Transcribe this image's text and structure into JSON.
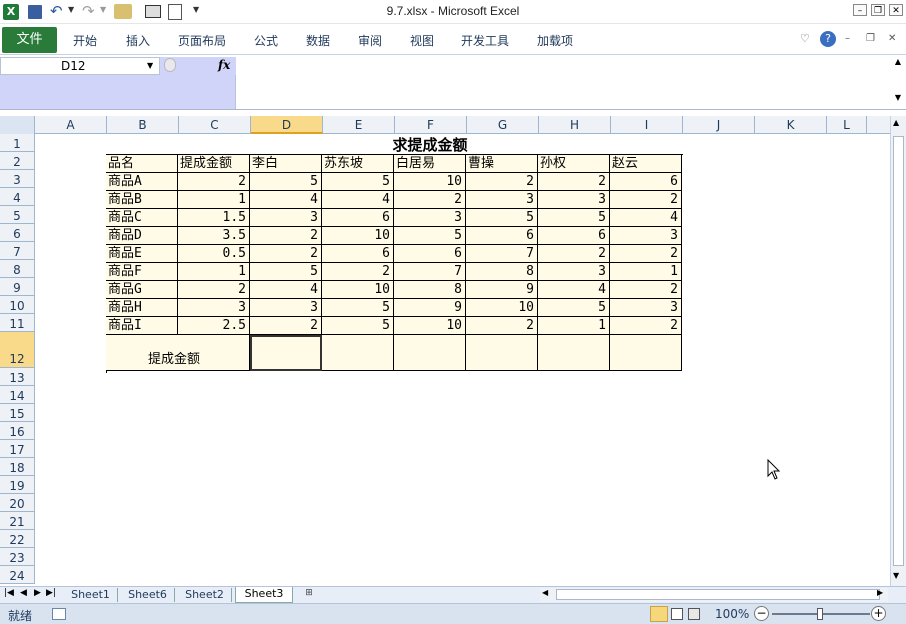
{
  "titlebar": {
    "title": "9.7.xlsx  -  Microsoft Excel"
  },
  "ribbon": {
    "file_tab": "文件",
    "tabs": [
      "开始",
      "插入",
      "页面布局",
      "公式",
      "数据",
      "审阅",
      "视图",
      "开发工具",
      "加载项"
    ]
  },
  "formula_bar": {
    "name_box": "D12",
    "fx_label": "fx",
    "formula": ""
  },
  "columns": [
    "A",
    "B",
    "C",
    "D",
    "E",
    "F",
    "G",
    "H",
    "I",
    "J",
    "K",
    "L"
  ],
  "rows": [
    "1",
    "2",
    "3",
    "4",
    "5",
    "6",
    "7",
    "8",
    "9",
    "10",
    "11",
    "12",
    "13",
    "14",
    "15",
    "16",
    "17",
    "18",
    "19",
    "20",
    "21",
    "22",
    "23",
    "24"
  ],
  "sheet": {
    "title": "求提成金额",
    "headers": [
      "品名",
      "提成金额",
      "李白",
      "苏东坡",
      "白居易",
      "曹操",
      "孙权",
      "赵云"
    ],
    "data_rows": [
      [
        "商品A",
        "2",
        "5",
        "5",
        "10",
        "2",
        "2",
        "6"
      ],
      [
        "商品B",
        "1",
        "4",
        "4",
        "2",
        "3",
        "3",
        "2"
      ],
      [
        "商品C",
        "1.5",
        "3",
        "6",
        "3",
        "5",
        "5",
        "4"
      ],
      [
        "商品D",
        "3.5",
        "2",
        "10",
        "5",
        "6",
        "6",
        "3"
      ],
      [
        "商品E",
        "0.5",
        "2",
        "6",
        "6",
        "7",
        "2",
        "2"
      ],
      [
        "商品F",
        "1",
        "5",
        "2",
        "7",
        "8",
        "3",
        "1"
      ],
      [
        "商品G",
        "2",
        "4",
        "10",
        "8",
        "9",
        "4",
        "2"
      ],
      [
        "商品H",
        "3",
        "3",
        "5",
        "9",
        "10",
        "5",
        "3"
      ],
      [
        "商品I",
        "2.5",
        "2",
        "5",
        "10",
        "2",
        "1",
        "2"
      ]
    ],
    "total_label": "提成金额"
  },
  "sheet_tabs": [
    "Sheet1",
    "Sheet6",
    "Sheet2",
    "Sheet3"
  ],
  "active_sheet": "Sheet3",
  "status": {
    "ready": "就绪",
    "zoom": "100%"
  },
  "colors": {
    "header_fill": "#fffbe6",
    "selected_col": "#f9d98a",
    "ribbon_file": "#2a7a3a"
  }
}
